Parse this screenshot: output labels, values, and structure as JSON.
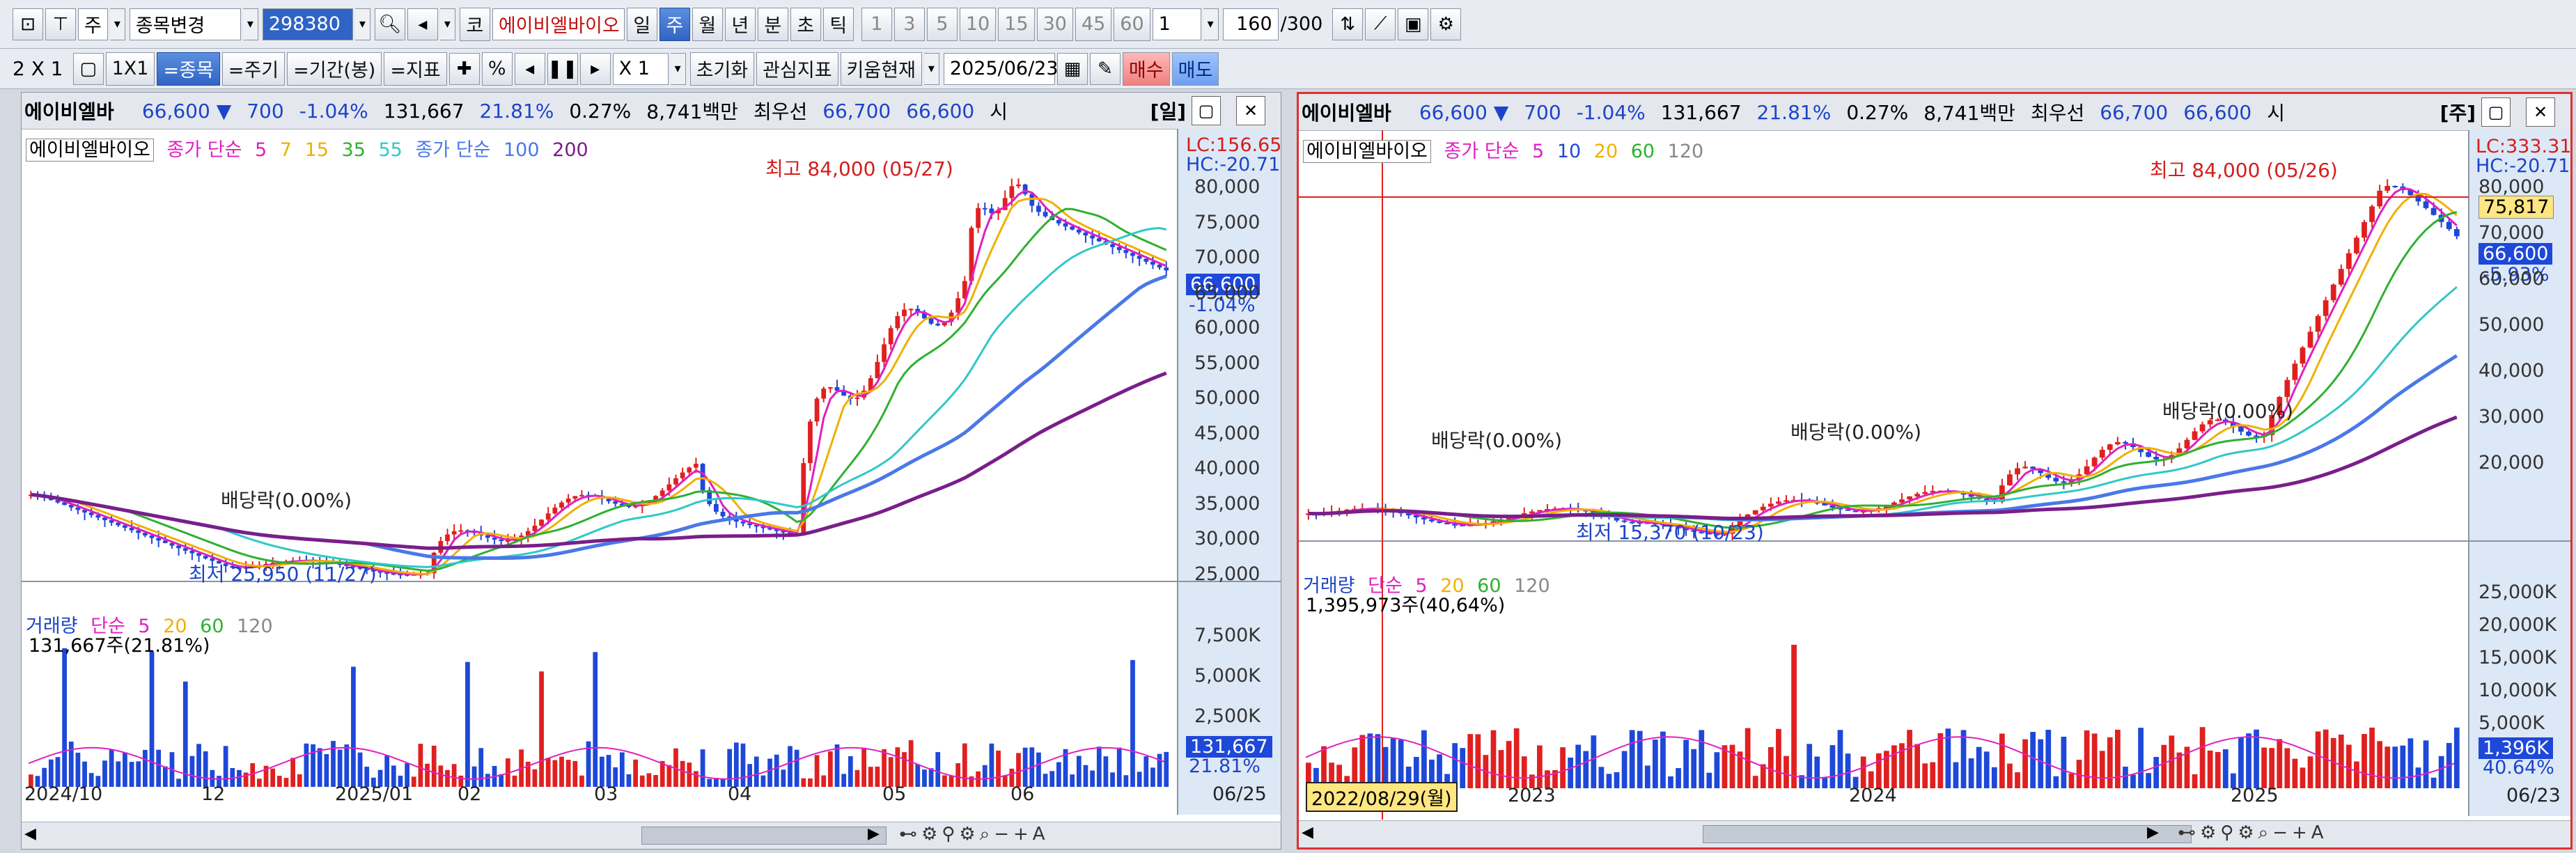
{
  "toolbar1": {
    "period_select": "주",
    "item_change": "종목변경",
    "code": "298380",
    "market_prefix": "코",
    "stock_name_short": "에이비엘바이오",
    "periods": [
      "일",
      "주",
      "월",
      "년",
      "분",
      "초",
      "틱"
    ],
    "active_period": "주",
    "intervals": [
      "1",
      "3",
      "5",
      "10",
      "15",
      "30",
      "45",
      "60"
    ],
    "count_value": "1",
    "data_count": "160",
    "data_total": "/300"
  },
  "toolbar2": {
    "layout": "2 X 1",
    "one_by_one": "1X1",
    "by_item": "=종목",
    "by_period": "=주기",
    "by_range": "=기간(봉)",
    "by_indicator": "=지표",
    "percent": "%",
    "multiplier": "X 1",
    "reset": "초기화",
    "interest_indicator": "관심지표",
    "kiwoom_current": "키움현재",
    "date": "2025/06/23",
    "buy": "매수",
    "sell": "매도"
  },
  "panel_left": {
    "name": "에이비엘바",
    "price": "66,600",
    "change": "700",
    "change_pct": "-1.04%",
    "volume": "131,667",
    "turnover_pct": "21.81%",
    "pct2": "0.27%",
    "amount": "8,741백만",
    "best_bid_label": "최우선",
    "ask": "66,700",
    "bid": "66,600",
    "market_label": "시",
    "period_tag": "[일]",
    "legend_name": "에이비엘바이오",
    "legend_ma_label": "종가 단순",
    "legend_ma_periods": [
      "5",
      "7",
      "15",
      "35",
      "55"
    ],
    "legend_ma2_label": "종가 단순",
    "legend_ma2_periods": [
      "100",
      "200"
    ],
    "lc": "LC:156.65",
    "hc": "HC:-20.71",
    "high_ann": "최고 84,000 (05/27)",
    "low_ann": "최저 25,950 (11/27)",
    "div_ann": "배당락(0.00%)",
    "price_tag": "66,600",
    "pct_tag": "-1.04%",
    "y_ticks": [
      "80,000",
      "75,000",
      "70,000",
      "65,000",
      "60,000",
      "55,000",
      "50,000",
      "45,000",
      "40,000",
      "35,000",
      "30,000",
      "25,000"
    ],
    "vol_legend_label": "거래량",
    "vol_legend_ma": "단순",
    "vol_legend_periods": [
      "5",
      "20",
      "60",
      "120"
    ],
    "vol_value": "131,667주(21.81%)",
    "vol_ticks": [
      "7,500K",
      "5,000K",
      "2,500K"
    ],
    "vol_tag": "131,667",
    "vol_pct_tag": "21.81%",
    "x_labels": [
      "2024/10",
      "12",
      "2025/01",
      "02",
      "03",
      "04",
      "05",
      "06"
    ],
    "x_end": "06/25"
  },
  "panel_right": {
    "name": "에이비엘바",
    "price": "66,600",
    "change": "700",
    "change_pct": "-1.04%",
    "volume": "131,667",
    "turnover_pct": "21.81%",
    "pct2": "0.27%",
    "amount": "8,741백만",
    "best_bid_label": "최우선",
    "ask": "66,700",
    "bid": "66,600",
    "market_label": "시",
    "period_tag": "[주]",
    "legend_name": "에이비엘바이오",
    "legend_ma_label": "종가 단순",
    "legend_ma_periods": [
      "5",
      "10",
      "20",
      "60",
      "120"
    ],
    "lc": "LC:333.31",
    "hc": "HC:-20.71",
    "high_ann": "최고 84,000 (05/26)",
    "low_ann": "최저 15,370 (10/23)",
    "div_ann1": "배당락(0.00%)",
    "div_ann2": "배당락(0.00%)",
    "div_ann3": "배당락(0.00%)",
    "cross_tag": "75,817",
    "price_tag": "66,600",
    "pct_tag": "-5.93%",
    "y_ticks": [
      "80,000",
      "70,000",
      "60,000",
      "50,000",
      "40,000",
      "30,000",
      "20,000"
    ],
    "vol_legend_label": "거래량",
    "vol_legend_ma": "단순",
    "vol_legend_periods": [
      "5",
      "20",
      "60",
      "120"
    ],
    "vol_value": "1,395,973주(40,64%)",
    "vol_ticks": [
      "25,000K",
      "20,000K",
      "15,000K",
      "10,000K",
      "5,000K"
    ],
    "vol_tag": "1,396K",
    "vol_pct_tag": "40.64%",
    "x_cursor_label": "2022/08/29(월)",
    "x_labels": [
      "2023",
      "2024",
      "2025"
    ],
    "x_end": "06/23"
  },
  "colors": {
    "up": "#e02020",
    "down": "#1e48d8",
    "ma5": "#e020c0",
    "ma7": "#f0b000",
    "ma15": "#30b030",
    "ma35": "#20a890",
    "ma55": "#30c8c8",
    "ma100": "#4a78e8",
    "ma200": "#7a1e8a"
  }
}
